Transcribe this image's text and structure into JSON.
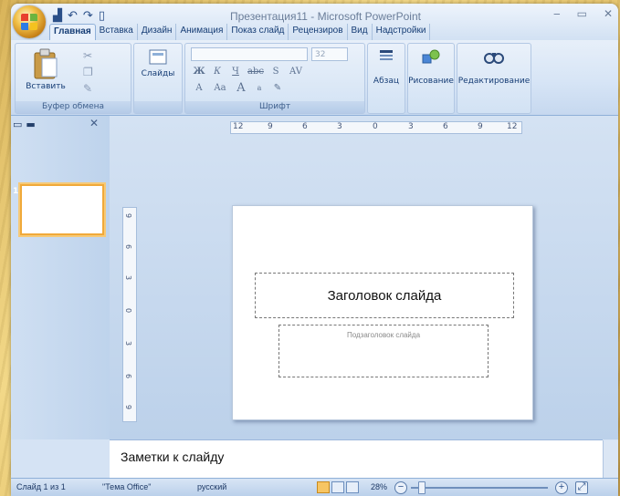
{
  "window": {
    "title": "Презентация11 - Microsoft PowerPoint",
    "controls": [
      "‒",
      "▭",
      "✕"
    ]
  },
  "quick_access": {
    "save": "▟",
    "undo": "↶",
    "redo": "↷",
    "new": "▯"
  },
  "tabs": [
    {
      "label": "Главная",
      "active": true
    },
    {
      "label": "Вставка"
    },
    {
      "label": "Дизайн"
    },
    {
      "label": "Анимация"
    },
    {
      "label": "Показ слайд"
    },
    {
      "label": "Рецензиров"
    },
    {
      "label": "Вид"
    },
    {
      "label": "Надстройки"
    }
  ],
  "ribbon": {
    "clipboard": {
      "paste_label": "Вставить",
      "group_label": "Буфер обмена"
    },
    "slides": {
      "label": "Слайды"
    },
    "font": {
      "font_name": "",
      "font_size": "32",
      "group_label": "Шрифт",
      "row1": [
        "Ж",
        "К",
        "Ч",
        "abc",
        "S",
        "AV"
      ],
      "row2": [
        "A",
        "Aa",
        "A",
        "a",
        "✎"
      ]
    },
    "paragraph": {
      "label": "Абзац"
    },
    "drawing": {
      "label": "Рисование"
    },
    "editing": {
      "label": "Редактирование"
    }
  },
  "side_panel": {
    "slide_number": "1"
  },
  "ruler": {
    "horizontal": [
      "12",
      "9",
      "6",
      "3",
      "0",
      "3",
      "6",
      "9",
      "12"
    ],
    "vertical": [
      "9",
      "6",
      "3",
      "0",
      "3",
      "6",
      "9"
    ]
  },
  "slide": {
    "title_placeholder": "Заголовок слайда",
    "subtitle_placeholder": "Подзаголовок слайда"
  },
  "notes": {
    "placeholder": "Заметки к слайду"
  },
  "status": {
    "slide_info": "Слайд 1 из 1",
    "theme": "\"Тема Office\"",
    "language": "русский",
    "zoom": "28%"
  },
  "colors": {
    "accent": "#f0a93a",
    "ribbon": "#d7e5f6",
    "background": "#e4c26b"
  }
}
